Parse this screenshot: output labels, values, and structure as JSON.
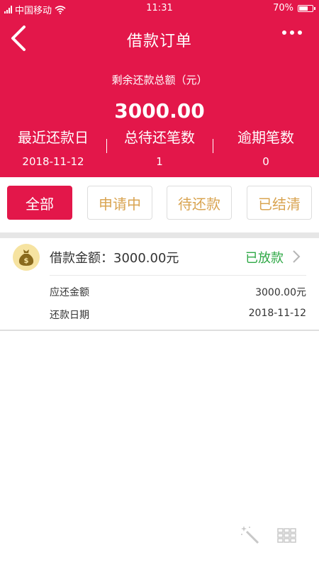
{
  "status_bar": {
    "carrier": "中国移动",
    "time": "11:31",
    "battery": "70%",
    "battery_level": 0.7
  },
  "nav": {
    "title": "借款订单",
    "back_icon": "chevron-left-icon",
    "more_icon": "more-horizontal-icon"
  },
  "summary": {
    "total_label": "剩余还款总额（元）",
    "total_amount": "3000.00",
    "stats": [
      {
        "label": "最近还款日",
        "value": "2018-11-12"
      },
      {
        "label": "总待还笔数",
        "value": "1"
      },
      {
        "label": "逾期笔数",
        "value": "0"
      }
    ]
  },
  "filters": [
    "全部",
    "申请中",
    "待还款",
    "已结清"
  ],
  "orders": [
    {
      "title": "借款金额：3000.00元",
      "status": "已放款",
      "icon": "money-bag-icon",
      "details": [
        {
          "key": "应还金额",
          "value": "3000.00元"
        },
        {
          "key": "还款日期",
          "value": "2018-11-12"
        }
      ]
    }
  ],
  "colors": {
    "primary": "#e3174a",
    "filter_text": "#d9a451",
    "status_ok": "#2ea845"
  },
  "bottom_tools": [
    "magic-wand-icon",
    "grid-icon"
  ]
}
